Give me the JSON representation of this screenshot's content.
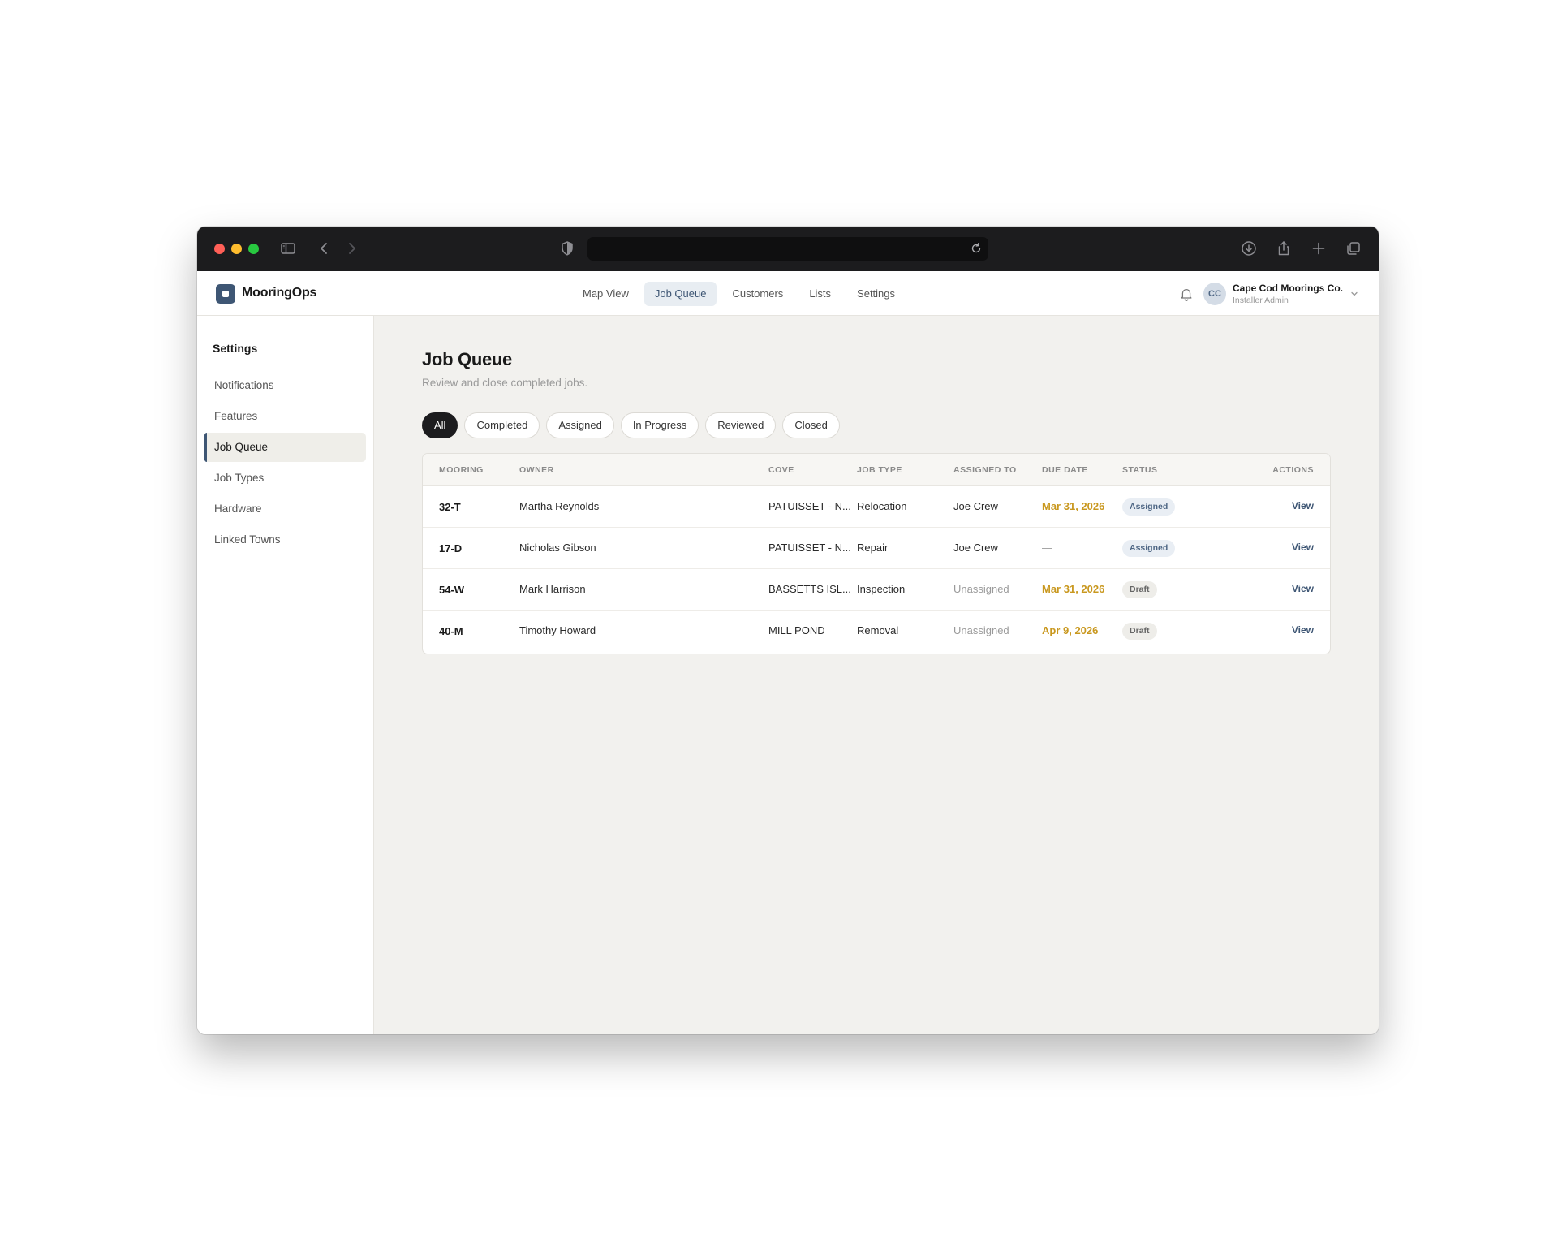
{
  "app": {
    "name": "MooringOps"
  },
  "topnav": {
    "items": [
      {
        "label": "Map View",
        "active": false
      },
      {
        "label": "Job Queue",
        "active": true
      },
      {
        "label": "Customers",
        "active": false
      },
      {
        "label": "Lists",
        "active": false
      },
      {
        "label": "Settings",
        "active": false
      }
    ]
  },
  "account": {
    "initials": "CC",
    "org": "Cape Cod Moorings Co.",
    "role": "Installer Admin"
  },
  "sidebar": {
    "title": "Settings",
    "items": [
      {
        "label": "Notifications",
        "active": false
      },
      {
        "label": "Features",
        "active": false
      },
      {
        "label": "Job Queue",
        "active": true
      },
      {
        "label": "Job Types",
        "active": false
      },
      {
        "label": "Hardware",
        "active": false
      },
      {
        "label": "Linked Towns",
        "active": false
      }
    ]
  },
  "page": {
    "title": "Job Queue",
    "subtitle": "Review and close completed jobs."
  },
  "filters": [
    {
      "label": "All",
      "active": true
    },
    {
      "label": "Completed",
      "active": false
    },
    {
      "label": "Assigned",
      "active": false
    },
    {
      "label": "In Progress",
      "active": false
    },
    {
      "label": "Reviewed",
      "active": false
    },
    {
      "label": "Closed",
      "active": false
    }
  ],
  "table": {
    "columns": {
      "mooring": "MOORING",
      "owner": "OWNER",
      "cove": "COVE",
      "job_type": "JOB TYPE",
      "assigned_to": "ASSIGNED TO",
      "due_date": "DUE DATE",
      "status": "STATUS",
      "actions": "ACTIONS"
    },
    "rows": [
      {
        "mooring": "32-T",
        "owner": "Martha Reynolds",
        "cove": "PATUISSET - N...",
        "job_type": "Relocation",
        "assigned_to": "Joe Crew",
        "due_date": "Mar 31, 2026",
        "status": "Assigned",
        "action": "View"
      },
      {
        "mooring": "17-D",
        "owner": "Nicholas Gibson",
        "cove": "PATUISSET - N...",
        "job_type": "Repair",
        "assigned_to": "Joe Crew",
        "due_date": "—",
        "status": "Assigned",
        "action": "View"
      },
      {
        "mooring": "54-W",
        "owner": "Mark Harrison",
        "cove": "BASSETTS ISL...",
        "job_type": "Inspection",
        "assigned_to": "Unassigned",
        "due_date": "Mar 31, 2026",
        "status": "Draft",
        "action": "View"
      },
      {
        "mooring": "40-M",
        "owner": "Timothy Howard",
        "cove": "MILL POND",
        "job_type": "Removal",
        "assigned_to": "Unassigned",
        "due_date": "Apr 9, 2026",
        "status": "Draft",
        "action": "View"
      }
    ]
  },
  "colors": {
    "accent": "#3e5674",
    "due_highlight": "#c9981f",
    "chrome_bg": "#1c1c1e",
    "page_bg": "#f2f1ee"
  },
  "icons": {
    "sidebar_toggle": "sidebar-toggle-icon",
    "back": "chevron-left-icon",
    "forward": "chevron-right-icon",
    "shield": "shield-icon",
    "reload": "reload-icon",
    "download": "download-icon",
    "share": "share-icon",
    "new_tab": "plus-icon",
    "tabs": "tabs-overview-icon",
    "bell": "bell-icon",
    "account_menu": "chevron-down-icon"
  }
}
